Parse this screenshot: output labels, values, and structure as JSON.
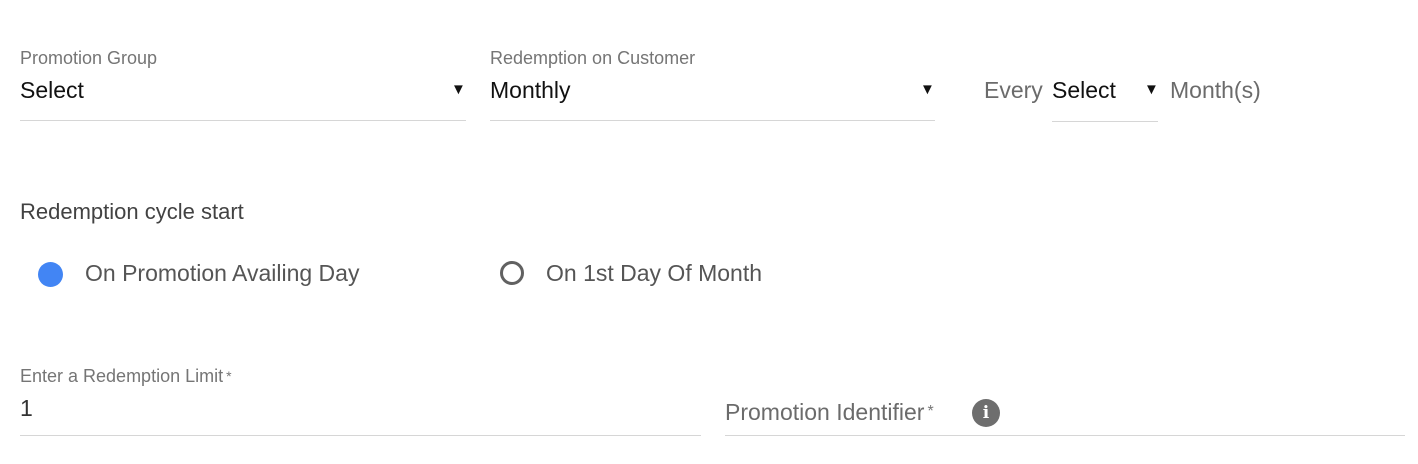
{
  "promotion_group": {
    "label": "Promotion Group",
    "value": "Select"
  },
  "redemption_on_customer": {
    "label": "Redemption on Customer",
    "value": "Monthly"
  },
  "frequency": {
    "prefix": "Every",
    "value": "Select",
    "suffix": "Month(s)"
  },
  "redemption_cycle": {
    "title": "Redemption cycle start",
    "options": [
      {
        "label": "On Promotion Availing Day",
        "selected": true
      },
      {
        "label": "On 1st Day Of Month",
        "selected": false
      }
    ]
  },
  "redemption_limit": {
    "label": "Enter a Redemption Limit",
    "required_mark": "*",
    "value": "1"
  },
  "promotion_identifier": {
    "placeholder": "Promotion Identifier",
    "required_mark": "*",
    "info_icon": "info-icon",
    "info_glyph": "i"
  },
  "colors": {
    "accent": "#4285f4",
    "label_gray": "#757575",
    "underline": "#d6d6d6",
    "info_icon_bg": "#6e6e6e"
  },
  "icons": {
    "dropdown": "caret-down-icon"
  }
}
